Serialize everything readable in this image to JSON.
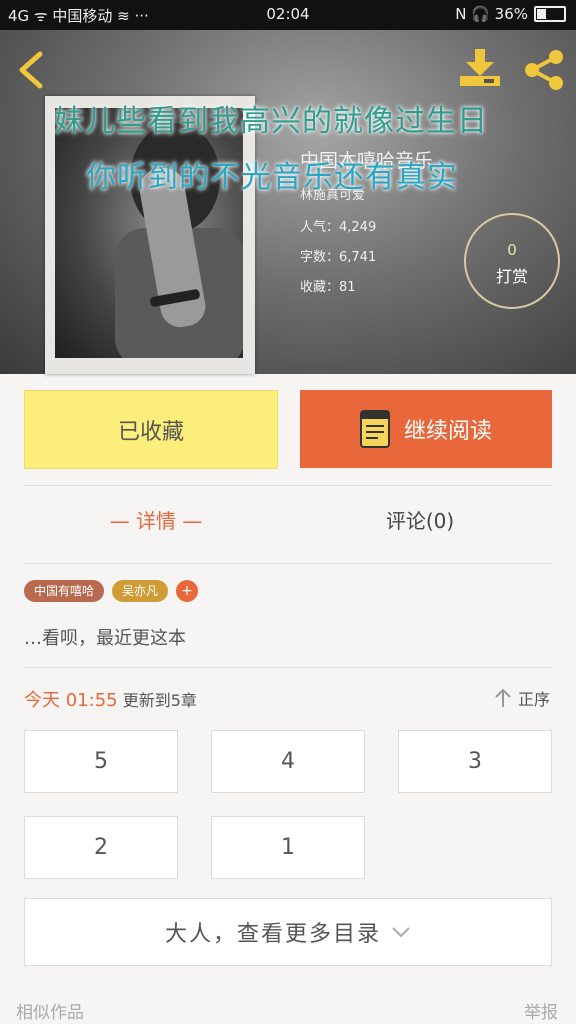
{
  "status": {
    "left": "4G ᯤ 中国移动 ≋ ···",
    "time": "02:04",
    "right": "N 🎧 36%"
  },
  "book": {
    "title": "中国本嘻哈音乐…",
    "author": "林施真可爱",
    "popularity_label": "人气：4,249",
    "words_label": "字数：6,741",
    "favorites_label": "收藏：81",
    "reward_count": "0",
    "reward_label": "打赏"
  },
  "overlay_lyrics": [
    "妹儿些看到我高兴的就像过生日",
    "你听到的不光音乐还有真实"
  ],
  "actions": {
    "collected_label": "已收藏",
    "continue_label": "继续阅读"
  },
  "tabs": {
    "detail": "— 详情 —",
    "comment": "评论(0)"
  },
  "tags": [
    "中国有嘻哈",
    "吴亦凡",
    "+"
  ],
  "description": "…看呗，最近更这本",
  "update": {
    "today": "今天 01:55",
    "text": "更新到5章",
    "sort_label": "正序"
  },
  "chapters": [
    "5",
    "4",
    "3",
    "2",
    "1"
  ],
  "more_catalog_label": "大人，查看更多目录",
  "footer": {
    "similar": "相似作品",
    "report": "举报"
  },
  "colors": {
    "accent": "#e8683b",
    "collect": "#fbee7a",
    "icons": "#f0c63c"
  },
  "icons": [
    "back-icon",
    "download-icon",
    "share-icon",
    "book-icon",
    "arrow-up-icon",
    "chevron-down-icon"
  ]
}
